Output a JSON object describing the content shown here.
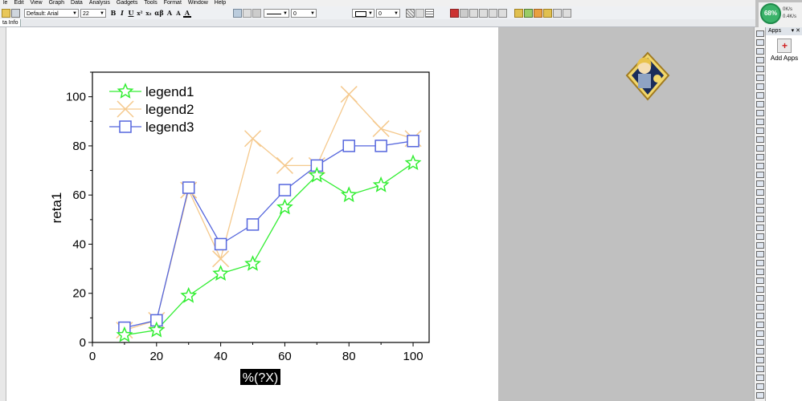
{
  "menu": [
    "le",
    "Edit",
    "View",
    "Graph",
    "Data",
    "Analysis",
    "Gadgets",
    "Tools",
    "Format",
    "Window",
    "Help"
  ],
  "toolbar": {
    "font_name": "Default: Arial",
    "font_size": "22",
    "bold": "B",
    "italic": "I",
    "underline": "U",
    "superscript": "x²",
    "subscript": "x₂",
    "greek": "αβ",
    "grow_font": "A",
    "shrink_font": "A",
    "font_color": "A",
    "line_width_value": "0",
    "border_width_value": "0"
  },
  "tabs": {
    "active": "ta Info"
  },
  "meter": {
    "percent": "68%",
    "up_rate": "0K/s",
    "down_rate": "0.4K/s"
  },
  "apps": {
    "header": "Apps",
    "header_controls": "▾ ✕",
    "add_apps_label": "Add Apps"
  },
  "chart_data": {
    "type": "line",
    "xlabel": "%(?X)",
    "ylabel": "reta1",
    "xlim": [
      0,
      105
    ],
    "ylim": [
      0,
      110
    ],
    "x_ticks": [
      0,
      20,
      40,
      60,
      80,
      100
    ],
    "y_ticks": [
      0,
      20,
      40,
      60,
      80,
      100
    ],
    "x": [
      10,
      20,
      30,
      40,
      50,
      60,
      70,
      80,
      90,
      100
    ],
    "legend_position": "top-left",
    "series": [
      {
        "name": "legend1",
        "color": "#33ee33",
        "marker": "star",
        "values": [
          3,
          5,
          19,
          28,
          32,
          55,
          68,
          60,
          64,
          73
        ]
      },
      {
        "name": "legend2",
        "color": "#f5c98d",
        "marker": "x",
        "values": [
          5,
          9,
          62,
          34,
          83,
          72,
          72,
          101,
          87,
          83
        ]
      },
      {
        "name": "legend3",
        "color": "#5566dd",
        "marker": "square",
        "values": [
          6,
          9,
          63,
          40,
          48,
          62,
          72,
          80,
          80,
          82
        ]
      }
    ]
  }
}
